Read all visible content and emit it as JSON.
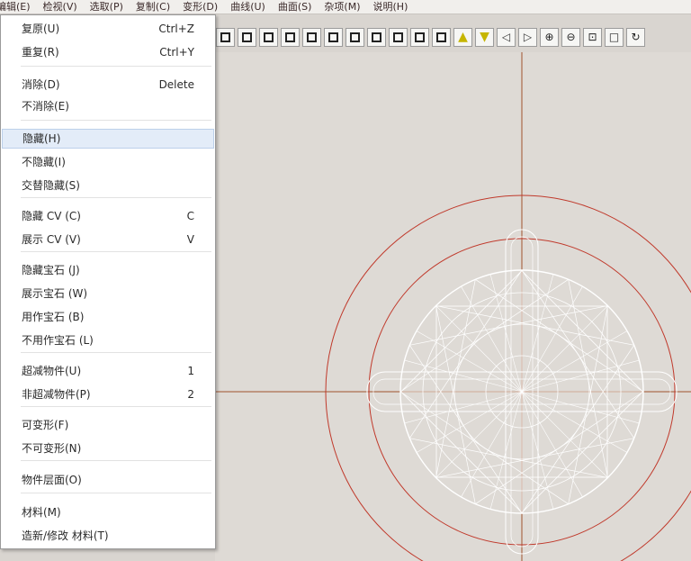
{
  "menubar": [
    "编辑(E)",
    "检视(V)",
    "选取(P)",
    "复制(C)",
    "变形(D)",
    "曲线(U)",
    "曲面(S)",
    "杂项(M)",
    "说明(H)"
  ],
  "menu_items": [
    {
      "label": "复原(U)",
      "shortcut": "Ctrl+Z"
    },
    {
      "label": "重复(R)",
      "shortcut": "Ctrl+Y"
    },
    {
      "label": "消除(D)",
      "shortcut": "Delete"
    },
    {
      "label": "不消除(E)",
      "shortcut": ""
    },
    {
      "label": "隐藏(H)",
      "shortcut": ""
    },
    {
      "label": "不隐藏(I)",
      "shortcut": ""
    },
    {
      "label": "交替隐藏(S)",
      "shortcut": ""
    },
    {
      "label": "隐藏 CV (C)",
      "shortcut": "C"
    },
    {
      "label": "展示 CV (V)",
      "shortcut": "V"
    },
    {
      "label": "隐藏宝石 (J)",
      "shortcut": ""
    },
    {
      "label": "展示宝石 (W)",
      "shortcut": ""
    },
    {
      "label": "用作宝石 (B)",
      "shortcut": ""
    },
    {
      "label": "不用作宝石 (L)",
      "shortcut": ""
    },
    {
      "label": "超减物件(U)",
      "shortcut": "1"
    },
    {
      "label": "非超减物件(P)",
      "shortcut": "2"
    },
    {
      "label": "可变形(F)",
      "shortcut": ""
    },
    {
      "label": "不可变形(N)",
      "shortcut": ""
    },
    {
      "label": "物件层面(O)",
      "shortcut": ""
    },
    {
      "label": "材料(M)",
      "shortcut": ""
    },
    {
      "label": "造新/修改 材料(T)",
      "shortcut": ""
    }
  ],
  "highlighted_item": "隐藏(H)",
  "toolbar_icons": [
    "view-left-icon",
    "view-front-icon",
    "view-back-icon",
    "view-right-icon",
    "view-top-icon",
    "view-bottom-icon",
    "view-quad-icon",
    "split-vertical-icon",
    "split-horizontal-icon",
    "grid-4-icon",
    "grid-9-icon",
    "arrow-up-icon",
    "arrow-down-icon",
    "arrow-left-icon",
    "arrow-right-icon",
    "zoom-in-icon",
    "zoom-out-icon",
    "zoom-window-icon",
    "zoom-extents-icon",
    "rotate-icon"
  ],
  "colors": {
    "viewport_bg": "#dedad5",
    "axis": "#a0522d",
    "ring": "#c0392b",
    "wireframe": "#ffffff",
    "highlight_bg": "#e3ecf8",
    "toolbar_triangle": "#c6b500"
  }
}
